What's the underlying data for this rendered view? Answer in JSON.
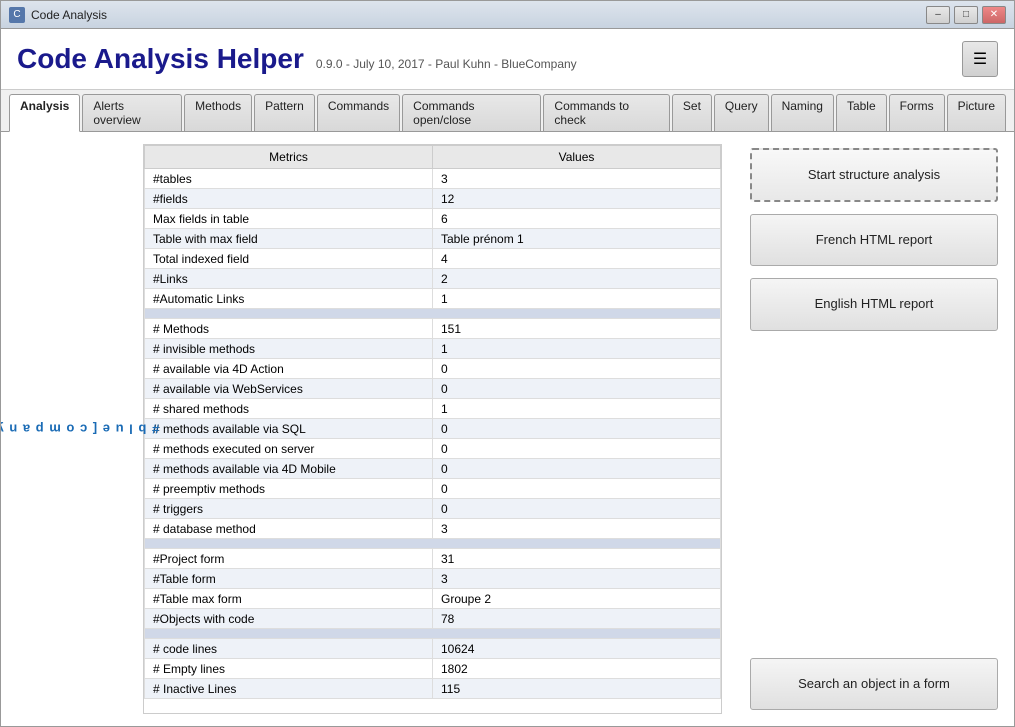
{
  "window": {
    "title": "Code Analysis"
  },
  "header": {
    "app_title": "Code Analysis Helper",
    "subtitle": "0.9.0 - July 10, 2017 - Paul Kuhn - BlueCompany",
    "menu_icon": "☰"
  },
  "tabs": [
    {
      "label": "Analysis",
      "active": true
    },
    {
      "label": "Alerts overview",
      "active": false
    },
    {
      "label": "Methods",
      "active": false
    },
    {
      "label": "Pattern",
      "active": false
    },
    {
      "label": "Commands",
      "active": false
    },
    {
      "label": "Commands open/close",
      "active": false
    },
    {
      "label": "Commands to check",
      "active": false
    },
    {
      "label": "Set",
      "active": false
    },
    {
      "label": "Query",
      "active": false
    },
    {
      "label": "Naming",
      "active": false
    },
    {
      "label": "Table",
      "active": false
    },
    {
      "label": "Forms",
      "active": false
    },
    {
      "label": "Picture",
      "active": false
    }
  ],
  "sidebar": {
    "logo_text": "#blue[company]"
  },
  "table": {
    "headers": [
      "Metrics",
      "Values"
    ],
    "rows": [
      {
        "metric": "#tables",
        "value": "3",
        "type": "data"
      },
      {
        "metric": "#fields",
        "value": "12",
        "type": "data"
      },
      {
        "metric": "Max fields in table",
        "value": "6",
        "type": "data"
      },
      {
        "metric": "Table with max field",
        "value": "Table prénom 1",
        "type": "data"
      },
      {
        "metric": "Total indexed field",
        "value": "4",
        "type": "data"
      },
      {
        "metric": "#Links",
        "value": "2",
        "type": "data"
      },
      {
        "metric": "#Automatic Links",
        "value": "1",
        "type": "data"
      },
      {
        "metric": "",
        "value": "",
        "type": "empty"
      },
      {
        "metric": "# Methods",
        "value": "151",
        "type": "data"
      },
      {
        "metric": "# invisible methods",
        "value": "1",
        "type": "data"
      },
      {
        "metric": "# available via 4D Action",
        "value": "0",
        "type": "data"
      },
      {
        "metric": "# available via WebServices",
        "value": "0",
        "type": "data"
      },
      {
        "metric": "# shared methods",
        "value": "1",
        "type": "data"
      },
      {
        "metric": "# methods available via SQL",
        "value": "0",
        "type": "data"
      },
      {
        "metric": "# methods executed on server",
        "value": "0",
        "type": "data"
      },
      {
        "metric": "# methods available via 4D Mobile",
        "value": "0",
        "type": "data"
      },
      {
        "metric": "# preemptiv methods",
        "value": "0",
        "type": "data"
      },
      {
        "metric": "# triggers",
        "value": "0",
        "type": "data"
      },
      {
        "metric": "# database method",
        "value": "3",
        "type": "data"
      },
      {
        "metric": "",
        "value": "",
        "type": "empty"
      },
      {
        "metric": "#Project form",
        "value": "31",
        "type": "data"
      },
      {
        "metric": "#Table form",
        "value": "3",
        "type": "data"
      },
      {
        "metric": "#Table max form",
        "value": "Groupe 2",
        "type": "data"
      },
      {
        "metric": "#Objects with code",
        "value": "78",
        "type": "data"
      },
      {
        "metric": "",
        "value": "",
        "type": "empty"
      },
      {
        "metric": "# code lines",
        "value": "10624",
        "type": "data"
      },
      {
        "metric": "# Empty lines",
        "value": "1802",
        "type": "data"
      },
      {
        "metric": "# Inactive Lines",
        "value": "115",
        "type": "data"
      }
    ]
  },
  "buttons": {
    "start_analysis": "Start structure analysis",
    "french_report": "French HTML report",
    "english_report": "English HTML report",
    "search_object": "Search an object in a form"
  },
  "title_bar_buttons": {
    "minimize": "–",
    "maximize": "□",
    "close": "✕"
  }
}
